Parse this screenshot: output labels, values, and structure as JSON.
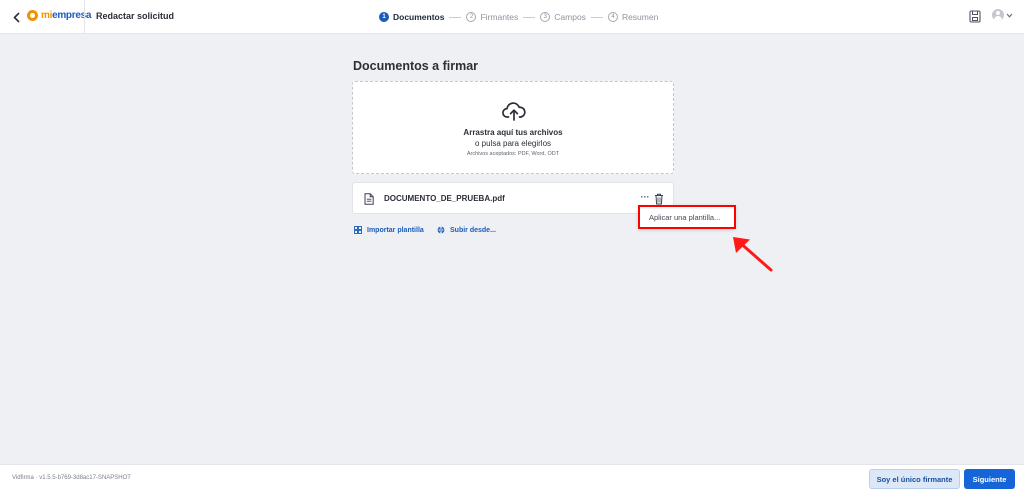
{
  "header": {
    "logo": {
      "mi": "mi",
      "empresa": "empresa"
    },
    "title": "Redactar solicitud",
    "steps": [
      {
        "num": "1",
        "label": "Documentos",
        "active": true
      },
      {
        "num": "2",
        "label": "Firmantes",
        "active": false
      },
      {
        "num": "3",
        "label": "Campos",
        "active": false
      },
      {
        "num": "4",
        "label": "Resumen",
        "active": false
      }
    ]
  },
  "main": {
    "section_title": "Documentos a firmar",
    "dropzone": {
      "line1": "Arrastra aquí tus archivos",
      "line2": "o pulsa para elegirlos",
      "line3": "Archivos aceptados: PDF, Word, ODT"
    },
    "file": {
      "name": "DOCUMENTO_DE_PRUEBA.pdf"
    },
    "dropdown": {
      "item": "Aplicar una plantilla..."
    },
    "links": {
      "import_template": "Importar plantilla",
      "upload_from": "Subir desde..."
    }
  },
  "footer": {
    "version": "Vidfirma  ·  v1.5.5-b769-3d8ac17-SNAPSHOT",
    "sole_signer_label": "Soy el único firmante",
    "next_label": "Siguiente"
  },
  "colors": {
    "accent": "#1a5cb8",
    "brand_orange": "#f39200",
    "highlight": "#ff0000"
  }
}
